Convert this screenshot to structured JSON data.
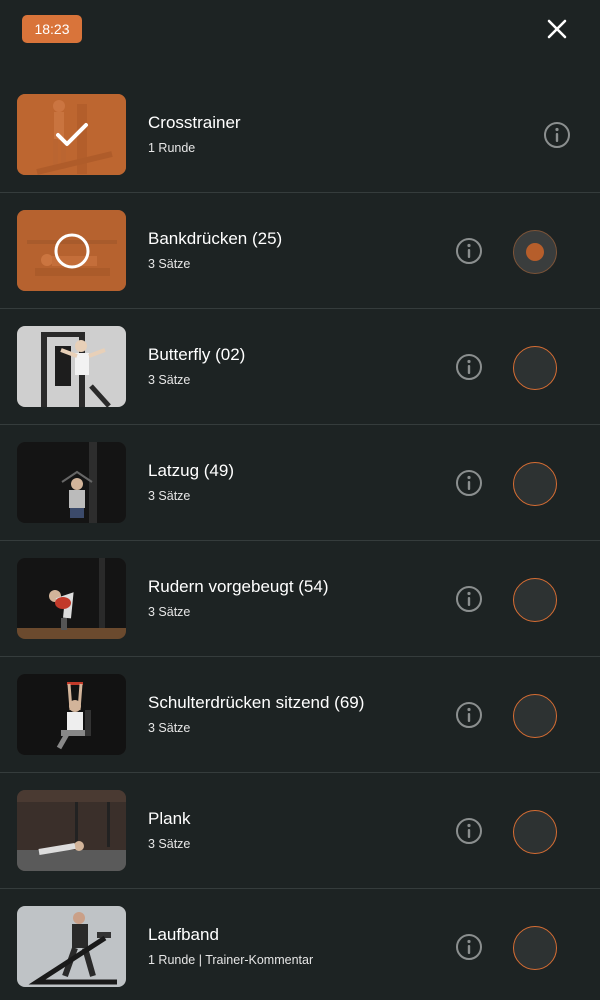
{
  "header": {
    "timer": "18:23",
    "close_icon": "close-icon"
  },
  "colors": {
    "accent": "#d9743a",
    "background": "#1d2323",
    "divider": "#353c3c"
  },
  "exercises": [
    {
      "title": "Crosstrainer",
      "subtitle": "1 Runde",
      "status": "done"
    },
    {
      "title": "Bankdrücken (25)",
      "subtitle": "3 Sätze",
      "status": "in-progress"
    },
    {
      "title": "Butterfly (02)",
      "subtitle": "3 Sätze",
      "status": "open"
    },
    {
      "title": "Latzug (49)",
      "subtitle": "3 Sätze",
      "status": "open"
    },
    {
      "title": "Rudern vorgebeugt (54)",
      "subtitle": "3 Sätze",
      "status": "open"
    },
    {
      "title": "Schulterdrücken sitzend (69)",
      "subtitle": "3 Sätze",
      "status": "open"
    },
    {
      "title": "Plank",
      "subtitle": "3 Sätze",
      "status": "open"
    },
    {
      "title": "Laufband",
      "subtitle": "1 Runde | Trainer-Kommentar",
      "status": "open"
    }
  ]
}
